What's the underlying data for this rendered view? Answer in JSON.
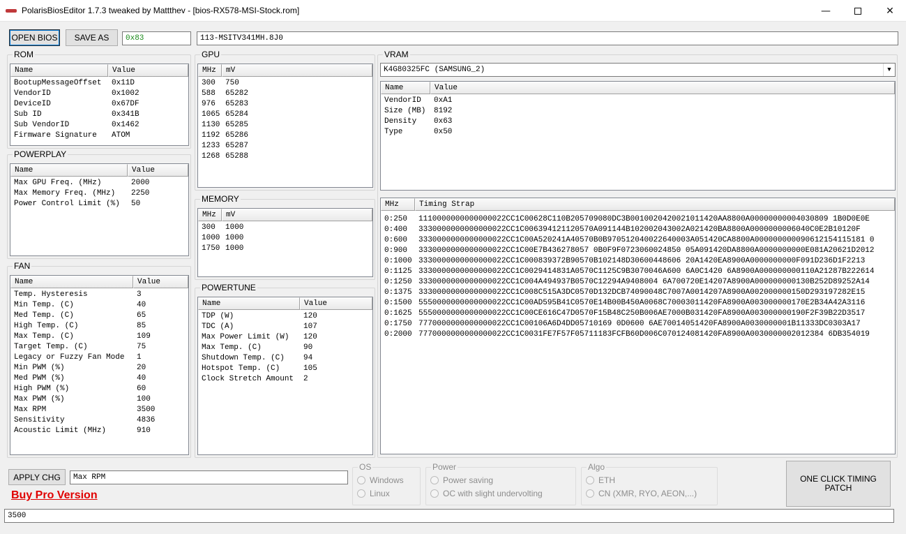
{
  "window": {
    "title": "PolarisBiosEditor 1.7.3 tweaked by Mattthev  - [bios-RX578-MSI-Stock.rom]",
    "brand_color": "#c0393b"
  },
  "toolbar": {
    "open_label": "OPEN BIOS",
    "save_label": "SAVE AS",
    "checksum": "0x83",
    "part_number": "113-MSITV341MH.8J0"
  },
  "rom": {
    "title": "ROM",
    "columns": [
      "Name",
      "Value"
    ],
    "rows": [
      [
        "BootupMessageOffset",
        "0x11D"
      ],
      [
        "VendorID",
        "0x1002"
      ],
      [
        "DeviceID",
        "0x67DF"
      ],
      [
        "Sub ID",
        "0x341B"
      ],
      [
        "Sub VendorID",
        "0x1462"
      ],
      [
        "Firmware Signature",
        "ATOM"
      ]
    ]
  },
  "powerplay": {
    "title": "POWERPLAY",
    "columns": [
      "Name",
      "Value"
    ],
    "rows": [
      [
        "Max GPU Freq. (MHz)",
        "2000"
      ],
      [
        "Max Memory Freq. (MHz)",
        "2250"
      ],
      [
        "Power Control Limit (%)",
        "50"
      ]
    ]
  },
  "fan": {
    "title": "FAN",
    "columns": [
      "Name",
      "Value"
    ],
    "rows": [
      [
        "Temp. Hysteresis",
        "3"
      ],
      [
        "Min Temp. (C)",
        "40"
      ],
      [
        "Med Temp. (C)",
        "65"
      ],
      [
        "High Temp. (C)",
        "85"
      ],
      [
        "Max Temp. (C)",
        "109"
      ],
      [
        "Target Temp. (C)",
        "75"
      ],
      [
        "Legacy or Fuzzy Fan Mode",
        "1"
      ],
      [
        "Min PWM (%)",
        "20"
      ],
      [
        "Med PWM (%)",
        "40"
      ],
      [
        "High PWM (%)",
        "60"
      ],
      [
        "Max PWM (%)",
        "100"
      ],
      [
        "Max RPM",
        "3500"
      ],
      [
        "Sensitivity",
        "4836"
      ],
      [
        "Acoustic Limit (MHz)",
        "910"
      ]
    ]
  },
  "gpu": {
    "title": "GPU",
    "columns": [
      "MHz",
      "mV"
    ],
    "rows": [
      [
        "300",
        "750"
      ],
      [
        "588",
        "65282"
      ],
      [
        "976",
        "65283"
      ],
      [
        "1065",
        "65284"
      ],
      [
        "1130",
        "65285"
      ],
      [
        "1192",
        "65286"
      ],
      [
        "1233",
        "65287"
      ],
      [
        "1268",
        "65288"
      ]
    ]
  },
  "memory": {
    "title": "MEMORY",
    "columns": [
      "MHz",
      "mV"
    ],
    "rows": [
      [
        "300",
        "1000"
      ],
      [
        "1000",
        "1000"
      ],
      [
        "1750",
        "1000"
      ]
    ]
  },
  "powertune": {
    "title": "POWERTUNE",
    "columns": [
      "Name",
      "Value"
    ],
    "rows": [
      [
        "TDP (W)",
        "120"
      ],
      [
        "TDC (A)",
        "107"
      ],
      [
        "Max Power Limit (W)",
        "120"
      ],
      [
        "Max Temp. (C)",
        "90"
      ],
      [
        "Shutdown Temp. (C)",
        "94"
      ],
      [
        "Hotspot Temp. (C)",
        "105"
      ],
      [
        "Clock Stretch Amount",
        "2"
      ]
    ]
  },
  "vram": {
    "title": "VRAM",
    "selected_module": "K4G80325FC (SAMSUNG_2)",
    "columns": [
      "Name",
      "Value"
    ],
    "rows": [
      [
        "VendorID",
        "0xA1"
      ],
      [
        "Size (MB)",
        "8192"
      ],
      [
        "Density",
        "0x63"
      ],
      [
        "Type",
        "0x50"
      ]
    ],
    "timing_columns": [
      "MHz",
      "Timing Strap"
    ],
    "timings": [
      [
        "0:250",
        "1110000000000000022CC1C00628C110B205709080DC3B0010020420021011420AA8800A00000000004030809 1B0D0E0E"
      ],
      [
        "0:400",
        "3330000000000000022CC1C006394121120570A091144B102002043002A021420BA8800A0000000006040C0E2B10120F"
      ],
      [
        "0:600",
        "3330000000000000022CC1C00A520241A40570B0B970512040022640003A051420CA8800A000000000090612154115181 0"
      ],
      [
        "0:900",
        "3330000000000000022CC1C00E7B436278057 0B0F9F0723060024850 05A091420DA8800A0000000000E081A20621D2012"
      ],
      [
        "0:1000",
        "3330000000000000022CC1C000839372B90570B102148D30600448606 20A1420EA8900A0000000000F091D236D1F2213"
      ],
      [
        "0:1125",
        "3330000000000000022CC1C0029414831A0570C1125C9B3070046A600 6A0C1420 6A8900A000000000110A21287B222614"
      ],
      [
        "0:1250",
        "3330000000000000022CC1C004A494937B0570C12294A9408004 6A700720E14207A8900A000000000130B252D89252A14"
      ],
      [
        "0:1375",
        "3330000000000000022CC1C008C515A3DC0570D132DCB74090048C7007A0014207A8900A002000000150D293197282E15"
      ],
      [
        "0:1500",
        "5550000000000000022CC1C00AD595B41C0570E14B00B450A0068C70003011420FA8900A003000000170E2B34A42A3116"
      ],
      [
        "0:1625",
        "5550000000000000022CC1C00CE616C47D0570F15B48C250B006AE7000B031420FA8900A003000000190F2F39B22D3517"
      ],
      [
        "0:1750",
        "7770000000000000022CC1C00106A6D4DD05710169 0D0600 6AE70014051420FA8900A0030000001B11333DC0303A17"
      ],
      [
        "0:2000",
        "7770000000000000022CC1C0031FE7F57F05711183FCFB60D006C070124081420FA8900A0030000002012384 6DB354019"
      ]
    ]
  },
  "bottom": {
    "apply_label": "APPLY CHG",
    "edit_name": "Max RPM",
    "edit_value": "3500",
    "buy_label": "Buy Pro Version",
    "os_title": "OS",
    "os_options": [
      "Windows",
      "Linux"
    ],
    "power_title": "Power",
    "power_options": [
      "Power saving",
      "OC with slight undervolting"
    ],
    "algo_title": "Algo",
    "algo_options": [
      "ETH",
      "CN (XMR, RYO, AEON,...)"
    ],
    "one_click_line1": "ONE CLICK TIMING",
    "one_click_line2": "PATCH"
  }
}
